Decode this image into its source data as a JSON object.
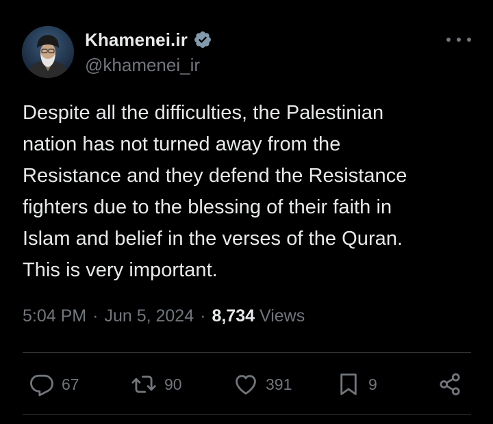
{
  "author": {
    "display_name": "Khamenei.ir",
    "handle": "@khamenei_ir",
    "verified": true
  },
  "icons": {
    "verified": "verified-badge-icon",
    "more": "more-dots-icon",
    "reply": "reply-icon",
    "retweet": "retweet-icon",
    "like": "heart-icon",
    "bookmark": "bookmark-icon",
    "share": "share-icon"
  },
  "tweet": {
    "text": "Despite all the difficulties, the Palestinian\nnation has not turned away from the\nResistance and they defend the Resistance\nfighters due to the blessing of their faith in\nIslam and belief in the verses of the Quran.\nThis is very important.",
    "time": "5:04 PM",
    "date": "Jun 5, 2024",
    "separator": "·",
    "views_count": "8,734",
    "views_label": "Views"
  },
  "actions": {
    "replies": "67",
    "retweets": "90",
    "likes": "391",
    "bookmarks": "9"
  },
  "colors": {
    "background": "#000000",
    "text_primary": "#e7e9ea",
    "text_secondary": "#71767b",
    "divider": "#2f3336",
    "verified_badge": "#829aab"
  }
}
